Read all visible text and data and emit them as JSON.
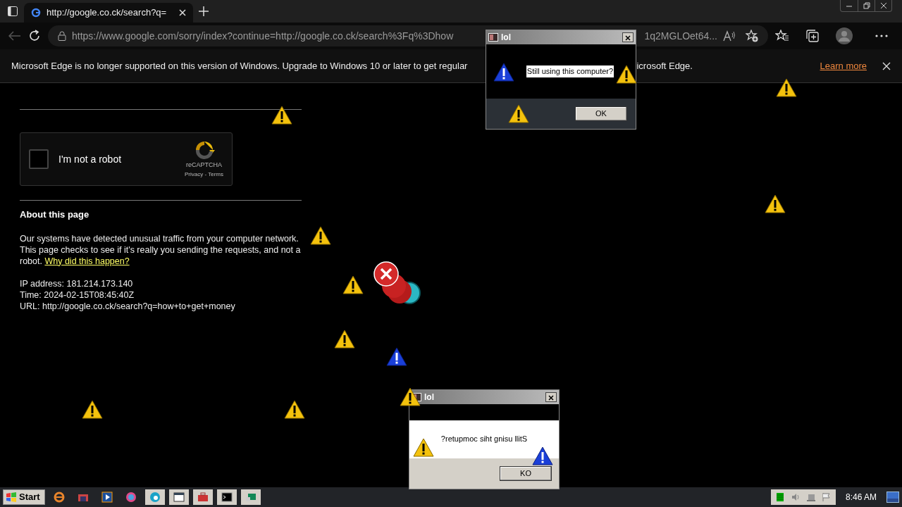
{
  "browser": {
    "tab": {
      "title": "http://google.co.ck/search?q=",
      "selected": true
    },
    "address": {
      "start": "https://www.google.com/sorry/index?continue=http://google.co.ck/search%3Fq%3Dhow",
      "end": "1q2MGLOet64..."
    }
  },
  "banner": {
    "message": "Microsoft Edge is no longer supported on this version of Windows. Upgrade to Windows 10 or later to get regular",
    "message_end": "icrosoft Edge.",
    "link": "Learn more"
  },
  "page": {
    "captcha": {
      "label": "I'm not a robot",
      "checked": false,
      "brand": "reCAPTCHA",
      "legal": "Privacy - Terms"
    },
    "heading": "About this page",
    "paragraph": "Our systems have detected unusual traffic from your computer network. This page checks to see if it's really you sending the requests, and not a robot.",
    "link": "Why did this happen?",
    "details": [
      "IP address: 181.214.173.140",
      "Time: 2024-02-15T08:45:40Z",
      "URL: http://google.co.ck/search?q=how+to+get+money"
    ]
  },
  "dialogs": [
    {
      "title": "lol",
      "message": "Still using this computer?",
      "button": "OK"
    },
    {
      "title": "lol",
      "message": "?retupmoc siht gnisu llitS",
      "button": "KO"
    }
  ],
  "taskbar": {
    "start": "Start",
    "clock": "8:46 AM"
  }
}
